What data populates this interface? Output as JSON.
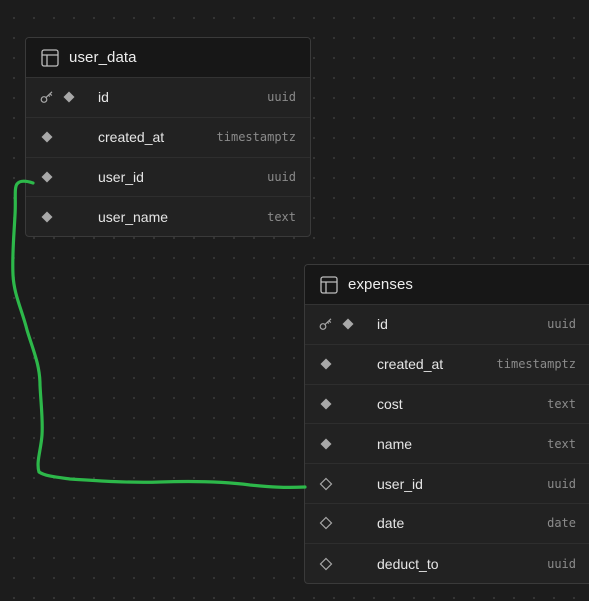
{
  "colors": {
    "background": "#1c1c1c",
    "card": "#222222",
    "header": "#171717",
    "connector": "#2db84a",
    "diamond_filled": "#a8a8a8",
    "diamond_outline": "#a8a8a8"
  },
  "tables": [
    {
      "name": "user_data",
      "icon": "table-icon",
      "columns": [
        {
          "name": "id",
          "type": "uuid",
          "primary_key": true,
          "required": true
        },
        {
          "name": "created_at",
          "type": "timestamptz",
          "primary_key": false,
          "required": true
        },
        {
          "name": "user_id",
          "type": "uuid",
          "primary_key": false,
          "required": true
        },
        {
          "name": "user_name",
          "type": "text",
          "primary_key": false,
          "required": true
        }
      ]
    },
    {
      "name": "expenses",
      "icon": "table-icon",
      "columns": [
        {
          "name": "id",
          "type": "uuid",
          "primary_key": true,
          "required": true
        },
        {
          "name": "created_at",
          "type": "timestamptz",
          "primary_key": false,
          "required": true
        },
        {
          "name": "cost",
          "type": "text",
          "primary_key": false,
          "required": true
        },
        {
          "name": "name",
          "type": "text",
          "primary_key": false,
          "required": true
        },
        {
          "name": "user_id",
          "type": "uuid",
          "primary_key": false,
          "required": false
        },
        {
          "name": "date",
          "type": "date",
          "primary_key": false,
          "required": false
        },
        {
          "name": "deduct_to",
          "type": "uuid",
          "primary_key": false,
          "required": false
        }
      ]
    }
  ],
  "relationship": {
    "from": "user_data.user_id",
    "to": "expenses.user_id",
    "style": "hand-drawn green line"
  }
}
